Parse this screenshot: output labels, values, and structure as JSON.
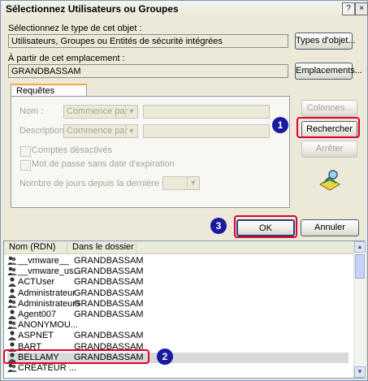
{
  "window": {
    "title": "Sélectionnez Utilisateurs ou Groupes",
    "help": "?",
    "close": "×"
  },
  "object_type": {
    "label": "Sélectionnez le type de cet objet :",
    "value": "Utilisateurs, Groupes ou Entités de sécurité intégrées",
    "button": "Types d'objet..."
  },
  "location": {
    "label": "À partir de cet emplacement :",
    "value": "GRANDBASSAM",
    "button": "Emplacements..."
  },
  "tab": {
    "label": "Requêtes communes"
  },
  "query": {
    "name_label": "Nom :",
    "name_mode": "Commence par",
    "desc_label": "Description :",
    "desc_mode": "Commence par",
    "disabled_accounts": "Comptes désactivés",
    "no_expire": "Mot de passe sans date d'expiration",
    "days_label": "Nombre de jours depuis la dernière session :"
  },
  "buttons": {
    "columns": "Colonnes...",
    "search": "Rechercher",
    "stop": "Arrêter",
    "ok": "OK",
    "cancel": "Annuler"
  },
  "list": {
    "headers": [
      "Nom (RDN)",
      "Dans le dossier"
    ],
    "rows": [
      {
        "name": "__vmware__",
        "folder": "GRANDBASSAM",
        "icon": "group-icon"
      },
      {
        "name": "__vmware_us...",
        "folder": "GRANDBASSAM",
        "icon": "group-icon"
      },
      {
        "name": "ACTUser",
        "folder": "GRANDBASSAM",
        "icon": "user-icon"
      },
      {
        "name": "Administrateur",
        "folder": "GRANDBASSAM",
        "icon": "user-icon"
      },
      {
        "name": "Administrateurs",
        "folder": "GRANDBASSAM",
        "icon": "group-icon"
      },
      {
        "name": "Agent007",
        "folder": "GRANDBASSAM",
        "icon": "user-icon"
      },
      {
        "name": "ANONYMOU...",
        "folder": "",
        "icon": "group-icon"
      },
      {
        "name": "ASPNET",
        "folder": "GRANDBASSAM",
        "icon": "user-icon"
      },
      {
        "name": "BART",
        "folder": "GRANDBASSAM",
        "icon": "user-icon"
      },
      {
        "name": "BELLAMY",
        "folder": "GRANDBASSAM",
        "icon": "user-icon"
      },
      {
        "name": "CRÉATEUR ...",
        "folder": "",
        "icon": "group-icon"
      }
    ]
  },
  "callouts": [
    "1",
    "2",
    "3"
  ],
  "colors": {
    "callout": "#e4002b",
    "badge": "#1a1aa0",
    "tab_accent": "#f4a93c"
  }
}
